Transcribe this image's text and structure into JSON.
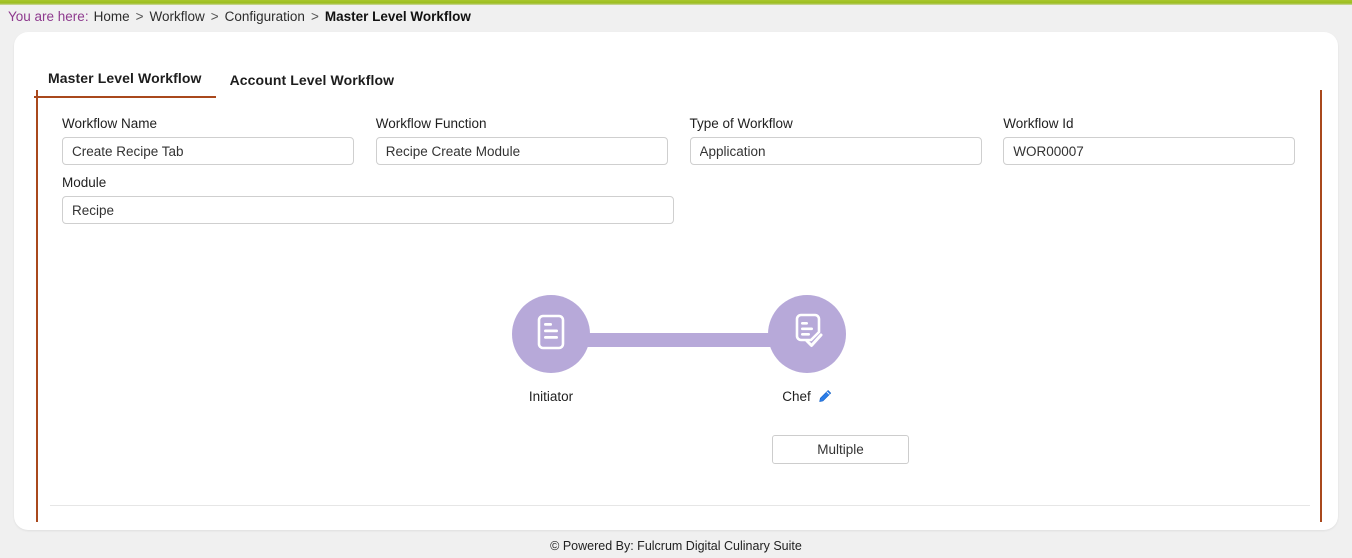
{
  "topbar": {
    "accent_color": "#a8c62c"
  },
  "breadcrumb": {
    "prefix": "You are here:",
    "items": [
      {
        "label": "Home",
        "current": false
      },
      {
        "label": "Workflow",
        "current": false
      },
      {
        "label": "Configuration",
        "current": false
      },
      {
        "label": "Master Level Workflow",
        "current": true
      }
    ],
    "separator": ">"
  },
  "tabs": [
    {
      "label": "Master Level Workflow",
      "active": true
    },
    {
      "label": "Account Level Workflow",
      "active": false
    }
  ],
  "form": {
    "fields": [
      {
        "label": "Workflow Name",
        "value": "Create Recipe Tab",
        "placeholder": "Workflow Name"
      },
      {
        "label": "Workflow Function",
        "value": "Recipe Create Module",
        "placeholder": "Workflow Function"
      },
      {
        "label": "Type of Workflow",
        "value": "Application",
        "placeholder": "Type of Workflow"
      },
      {
        "label": "Workflow Id",
        "value": "WOR00007",
        "placeholder": "Workflow Id"
      },
      {
        "label": "Module",
        "value": "Recipe",
        "placeholder": "Module"
      }
    ]
  },
  "diagram": {
    "node_color": "#b7a9d9",
    "connector_color": "#b7a9d9",
    "nodes": [
      {
        "label": "Initiator",
        "icon": "document-lines-icon",
        "editable": false
      },
      {
        "label": "Chef",
        "icon": "document-check-icon",
        "editable": true,
        "edit_icon": "pencil-edit-icon",
        "edit_icon_color": "#1a73e8"
      }
    ],
    "multiple_button": {
      "label": "Multiple"
    }
  },
  "footer": {
    "text": "© Powered By: Fulcrum Digital Culinary Suite"
  }
}
